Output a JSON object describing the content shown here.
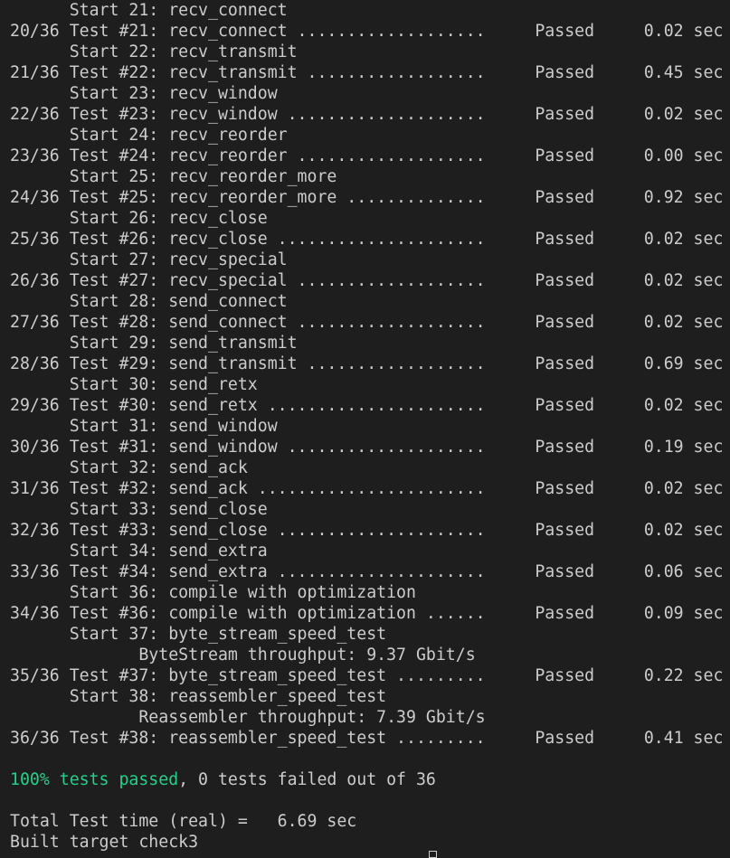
{
  "colors": {
    "background": "#1e1e1e",
    "text": "#cccccc",
    "success": "#23d18b"
  },
  "tests": [
    {
      "start_label": "Start 21: recv_connect",
      "index": "20/36",
      "number": "#21",
      "name": "recv_connect",
      "status": "Passed",
      "time": "0.02 sec"
    },
    {
      "start_label": "Start 22: recv_transmit",
      "index": "21/36",
      "number": "#22",
      "name": "recv_transmit",
      "status": "Passed",
      "time": "0.45 sec"
    },
    {
      "start_label": "Start 23: recv_window",
      "index": "22/36",
      "number": "#23",
      "name": "recv_window",
      "status": "Passed",
      "time": "0.02 sec"
    },
    {
      "start_label": "Start 24: recv_reorder",
      "index": "23/36",
      "number": "#24",
      "name": "recv_reorder",
      "status": "Passed",
      "time": "0.00 sec"
    },
    {
      "start_label": "Start 25: recv_reorder_more",
      "index": "24/36",
      "number": "#25",
      "name": "recv_reorder_more",
      "status": "Passed",
      "time": "0.92 sec"
    },
    {
      "start_label": "Start 26: recv_close",
      "index": "25/36",
      "number": "#26",
      "name": "recv_close",
      "status": "Passed",
      "time": "0.02 sec"
    },
    {
      "start_label": "Start 27: recv_special",
      "index": "26/36",
      "number": "#27",
      "name": "recv_special",
      "status": "Passed",
      "time": "0.02 sec"
    },
    {
      "start_label": "Start 28: send_connect",
      "index": "27/36",
      "number": "#28",
      "name": "send_connect",
      "status": "Passed",
      "time": "0.02 sec"
    },
    {
      "start_label": "Start 29: send_transmit",
      "index": "28/36",
      "number": "#29",
      "name": "send_transmit",
      "status": "Passed",
      "time": "0.69 sec"
    },
    {
      "start_label": "Start 30: send_retx",
      "index": "29/36",
      "number": "#30",
      "name": "send_retx",
      "status": "Passed",
      "time": "0.02 sec"
    },
    {
      "start_label": "Start 31: send_window",
      "index": "30/36",
      "number": "#31",
      "name": "send_window",
      "status": "Passed",
      "time": "0.19 sec"
    },
    {
      "start_label": "Start 32: send_ack",
      "index": "31/36",
      "number": "#32",
      "name": "send_ack",
      "status": "Passed",
      "time": "0.02 sec"
    },
    {
      "start_label": "Start 33: send_close",
      "index": "32/36",
      "number": "#33",
      "name": "send_close",
      "status": "Passed",
      "time": "0.02 sec"
    },
    {
      "start_label": "Start 34: send_extra",
      "index": "33/36",
      "number": "#34",
      "name": "send_extra",
      "status": "Passed",
      "time": "0.06 sec"
    },
    {
      "start_label": "Start 36: compile with optimization",
      "index": "34/36",
      "number": "#36",
      "name": "compile with optimization",
      "status": "Passed",
      "time": "0.09 sec"
    },
    {
      "start_label": "Start 37: byte_stream_speed_test",
      "extra": "ByteStream throughput: 9.37 Gbit/s",
      "index": "35/36",
      "number": "#37",
      "name": "byte_stream_speed_test",
      "status": "Passed",
      "time": "0.22 sec"
    },
    {
      "start_label": "Start 38: reassembler_speed_test",
      "extra": "Reassembler throughput: 7.39 Gbit/s",
      "index": "36/36",
      "number": "#38",
      "name": "reassembler_speed_test",
      "status": "Passed",
      "time": "0.41 sec"
    }
  ],
  "summary": {
    "pass_text": "100% tests passed",
    "rest_text": ", 0 tests failed out of 36"
  },
  "total_time_line": "Total Test time (real) =   6.69 sec",
  "built_line": "Built target check3"
}
